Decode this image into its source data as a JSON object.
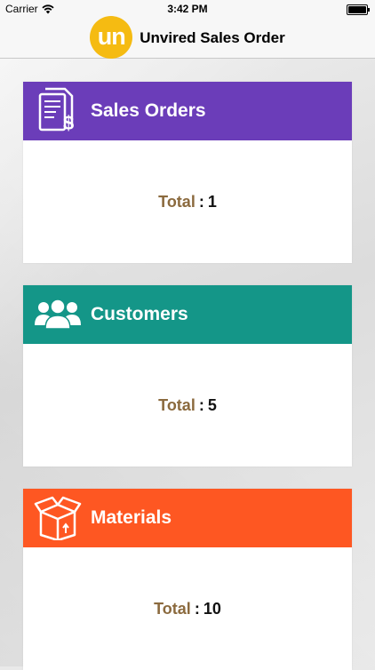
{
  "status_bar": {
    "carrier": "Carrier",
    "time": "3:42 PM"
  },
  "nav": {
    "logo_text": "un",
    "title": "Unvired Sales Order"
  },
  "colors": {
    "sales": "#6b3db9",
    "customers": "#149688",
    "materials": "#fe5722",
    "logo": "#f5bb12"
  },
  "cards": [
    {
      "title": "Sales Orders",
      "total_label": "Total",
      "separator": ":",
      "total_value": "1"
    },
    {
      "title": "Customers",
      "total_label": "Total",
      "separator": ":",
      "total_value": "5"
    },
    {
      "title": "Materials",
      "total_label": "Total",
      "separator": ":",
      "total_value": "10"
    }
  ]
}
